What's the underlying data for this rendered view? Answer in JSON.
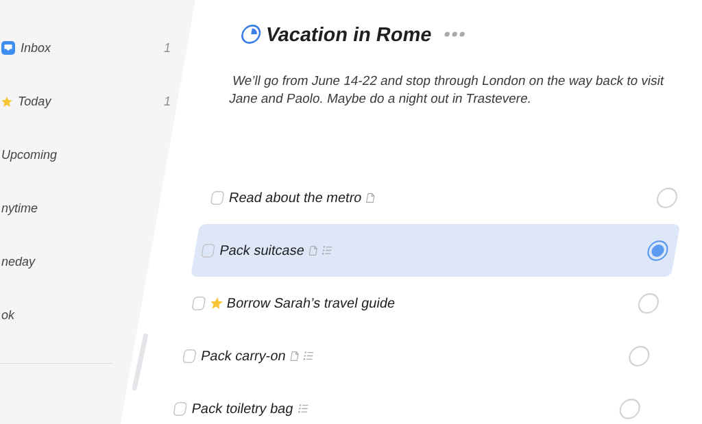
{
  "sidebar": {
    "items": [
      {
        "label": "Inbox",
        "kind": "inbox",
        "count": "1",
        "selected": false
      },
      {
        "label": "Today",
        "kind": "today",
        "count": "1",
        "selected": false
      },
      {
        "label": "Upcoming",
        "kind": "plain",
        "selected": false
      },
      {
        "label": "nytime",
        "kind": "plain",
        "selected": false
      },
      {
        "label": "neday",
        "kind": "plain",
        "selected": false
      },
      {
        "label": "ok",
        "kind": "plain",
        "selected": false
      }
    ]
  },
  "project": {
    "title": "Vacation in Rome",
    "level": 0.25,
    "notes": "We’ll go from June 14-22 and stop through London on the way back to visit Jane and Paolo. Maybe do a night out in Trastevere."
  },
  "tasks": [
    {
      "title": "Read about the metro",
      "checked": false,
      "starred": false,
      "notes": true,
      "checklist": false,
      "selected": false
    },
    {
      "title": "Pack suitcase",
      "checked": false,
      "starred": false,
      "notes": true,
      "checklist": true,
      "selected": true
    },
    {
      "title": "Borrow Sarah’s travel guide",
      "checked": false,
      "starred": true,
      "notes": false,
      "checklist": false,
      "selected": false
    },
    {
      "title": "Pack carry-on",
      "checked": false,
      "starred": false,
      "notes": true,
      "checklist": true,
      "selected": false
    },
    {
      "title": "Pack toiletry bag",
      "checked": false,
      "starred": false,
      "notes": false,
      "checklist": true,
      "selected": false
    }
  ]
}
